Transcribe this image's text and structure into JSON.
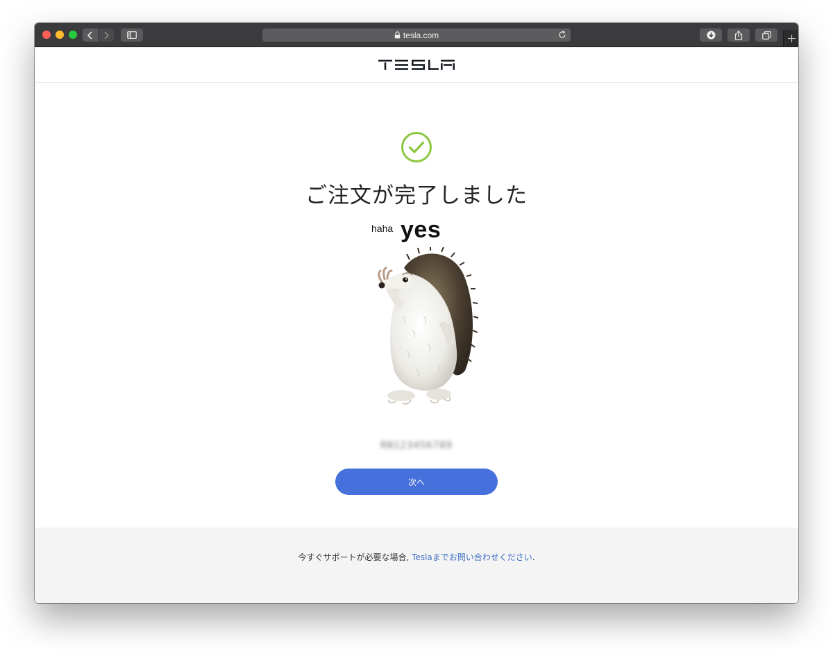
{
  "browser": {
    "url": "tesla.com"
  },
  "site": {
    "logo_text": "TESLA"
  },
  "confirmation": {
    "headline": "ご注文が完了しました",
    "meme_small": "haha",
    "meme_big": "yes",
    "order_number": "RN123456789",
    "next_button_label": "次へ"
  },
  "footer": {
    "support_prefix": "今すぐサポートが必要な場合, ",
    "support_link": "Teslaまでお問い合わせください",
    "support_suffix": "."
  },
  "colors": {
    "check_green": "#8cc63f",
    "button_blue": "#4670db",
    "link_blue": "#3e6fc6"
  }
}
